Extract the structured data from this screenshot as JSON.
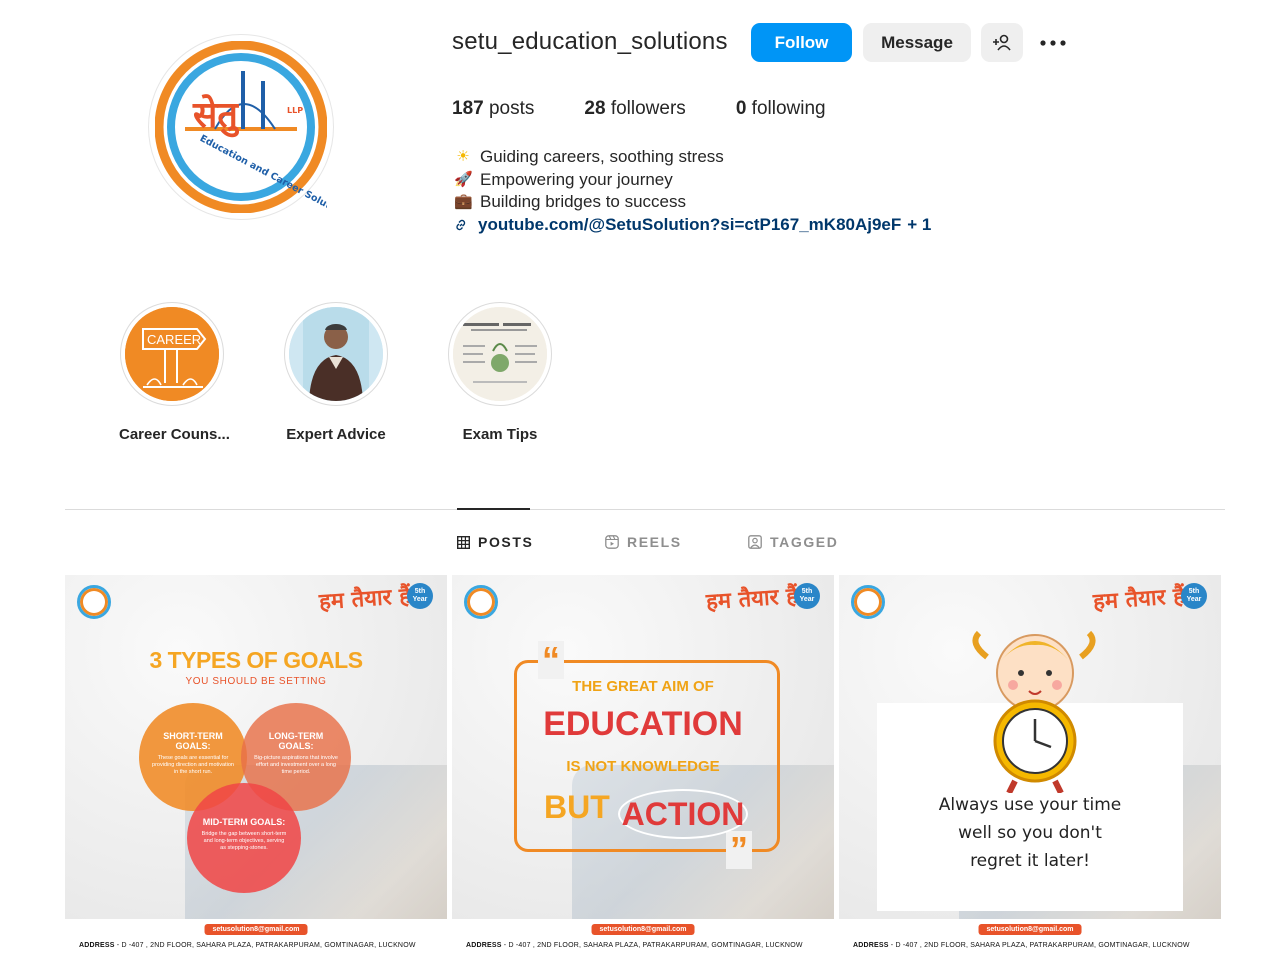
{
  "profile": {
    "username": "setu_education_solutions",
    "follow_label": "Follow",
    "message_label": "Message",
    "stats": {
      "posts_count": "187",
      "posts_label": "posts",
      "followers_count": "28",
      "followers_label": "followers",
      "following_count": "0",
      "following_label": "following"
    },
    "bio": [
      {
        "emoji": "☀",
        "text": "Guiding careers, soothing stress"
      },
      {
        "emoji": "🚀",
        "text": "Empowering your journey"
      },
      {
        "emoji": "💼",
        "text": "Building bridges to success"
      }
    ],
    "link_text": "youtube.com/@SetuSolution?si=ctP167_mK80Aj9eF",
    "link_more": "+ 1",
    "logo_text": {
      "brand": "सेतु",
      "llp": "LLP",
      "tagline": "Education and Career Solutions"
    }
  },
  "highlights": [
    {
      "label": "Career Couns...",
      "image_text": "CAREER"
    },
    {
      "label": "Expert Advice",
      "image_text": ""
    },
    {
      "label": "Exam Tips",
      "image_text": ""
    }
  ],
  "tabs": [
    {
      "label": "POSTS",
      "icon": "grid-icon",
      "active": true
    },
    {
      "label": "REELS",
      "icon": "reels-icon",
      "active": false
    },
    {
      "label": "TAGGED",
      "icon": "tagged-icon",
      "active": false
    }
  ],
  "posts": {
    "common": {
      "brand": "हम तैयार हैं",
      "year": "5th Year",
      "email": "setusolution8@gmail.com",
      "address_label": "ADDRESS",
      "address": "- D -407 , 2ND FLOOR, SAHARA PLAZA, PATRAKARPURAM, GOMTINAGAR, LUCKNOW"
    },
    "p1": {
      "title": "3 TYPES OF GOALS",
      "subtitle": "YOU SHOULD BE SETTING",
      "short_title": "SHORT-TERM GOALS:",
      "short_text": "These goals are essential for providing direction and motivation in the short run.",
      "long_title": "LONG-TERM GOALS:",
      "long_text": "Big-picture aspirations that involve effort and investment over a long time period.",
      "mid_title": "MID-TERM GOALS:",
      "mid_text": "Bridge the gap between short-term and long-term objectives, serving as stepping-stones."
    },
    "p2": {
      "line1": "THE GREAT AIM OF",
      "line2": "EDUCATION",
      "line3": "IS NOT KNOWLEDGE",
      "line4a": "BUT",
      "line4b": "ACTION"
    },
    "p3": {
      "line1": "Always use your time",
      "line2": "well so you don't",
      "line3": "regret it later!"
    }
  },
  "colors": {
    "follow": "#0095f6",
    "link": "#00376b",
    "orange": "#f08a24",
    "blue": "#3aa7e0",
    "red": "#e8532a"
  }
}
